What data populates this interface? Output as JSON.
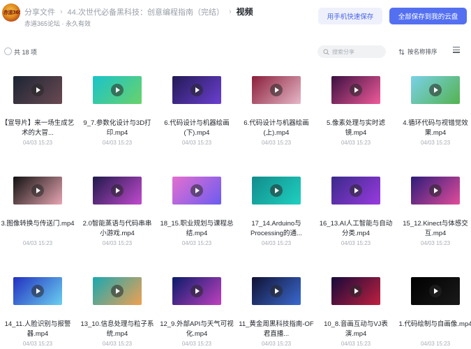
{
  "header": {
    "avatar_text": "赤道365",
    "breadcrumb": [
      "分享文件",
      "44.次世代必备黑科技：创意编程指南（完结）"
    ],
    "current": "视频",
    "separator": "›",
    "share_info": "赤道365论坛 · 永久有效",
    "btn_mobile": "用手机快速保存",
    "btn_saveall": "全部保存到我的云盘"
  },
  "toolbar": {
    "count": "共 18 项",
    "search_placeholder": "搜索分享",
    "sort_label": "按名称排序"
  },
  "files": [
    {
      "title": "【宣导片】来一场生成艺术的大冒...",
      "date": "04/03 15:23"
    },
    {
      "title": "9_7.参数化设计与3D打印.mp4",
      "date": "04/03 15:23"
    },
    {
      "title": "6.代码设计与机器绘画(下).mp4",
      "date": "04/03 15:23"
    },
    {
      "title": "6.代码设计与机器绘画(上).mp4",
      "date": "04/03 15:23"
    },
    {
      "title": "5.像素处理与实时滤镜.mp4",
      "date": "04/03 15:23"
    },
    {
      "title": "4.循环代码与视错觉效果.mp4",
      "date": "04/03 15:23"
    },
    {
      "title": "3.图像转换与传送门.mp4",
      "date": "04/03 15:23"
    },
    {
      "title": "2.0智能蒸语与代码串串小游戏.mp4",
      "date": "04/03 15:23"
    },
    {
      "title": "18_15.职业规划与课程总结.mp4",
      "date": "04/03 15:23"
    },
    {
      "title": "17_14.Arduino与Processing的通...",
      "date": "04/03 15:23"
    },
    {
      "title": "16_13.AI人工智能与自动分类.mp4",
      "date": "04/03 15:23"
    },
    {
      "title": "15_12.Kinect与体感交互.mp4",
      "date": "04/03 15:23"
    },
    {
      "title": "14_11.人脸识别与报警器.mp4",
      "date": "04/03 15:23"
    },
    {
      "title": "13_10.信息处理与粒子系统.mp4",
      "date": "04/03 15:23"
    },
    {
      "title": "12_9.外部API与天气可视化.mp4",
      "date": "04/03 15:23"
    },
    {
      "title": "11_黄金周黑科技指南-OF君直播...",
      "date": "04/03 15:23"
    },
    {
      "title": "10_8.音画互动与VJ表演.mp4",
      "date": "04/03 15:23"
    },
    {
      "title": "1.代码绘制与自画像.mp4",
      "date": "04/03 15:23"
    }
  ],
  "thumb_colors": [
    [
      "#1c2434",
      "#6a4a52"
    ],
    [
      "#19c4c9",
      "#6ad26a"
    ],
    [
      "#231a55",
      "#6b3fd1"
    ],
    [
      "#8a1e3a",
      "#e6b8c8"
    ],
    [
      "#3a1040",
      "#f05a9a"
    ],
    [
      "#7ad1e8",
      "#54b34f"
    ],
    [
      "#111111",
      "#e8a6b2"
    ],
    [
      "#201a4a",
      "#c24ad0"
    ],
    [
      "#e46fd0",
      "#6b5cf0"
    ],
    [
      "#118c8c",
      "#1fd0c0"
    ],
    [
      "#3a2a8a",
      "#9a3ae0"
    ],
    [
      "#2d1c7a",
      "#e24c9a"
    ],
    [
      "#2230c0",
      "#6ad0f0"
    ],
    [
      "#1aa8b0",
      "#f0a050"
    ],
    [
      "#0a1c6a",
      "#c040c0"
    ],
    [
      "#111133",
      "#3a6ad0"
    ],
    [
      "#150a3a",
      "#c02040"
    ],
    [
      "#000000",
      "#1a1a1a"
    ]
  ]
}
